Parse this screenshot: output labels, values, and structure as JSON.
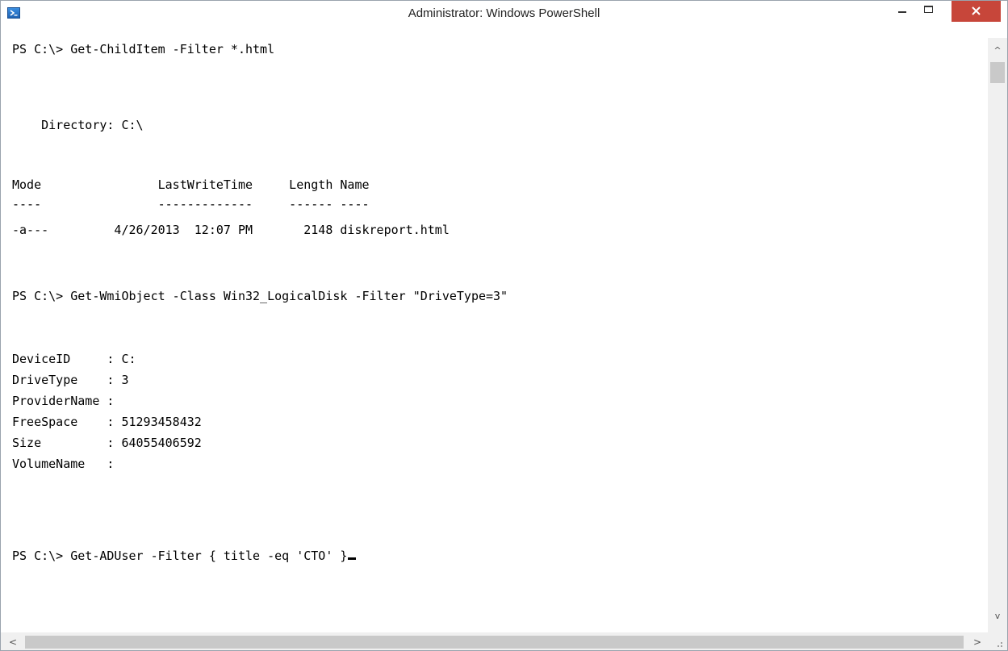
{
  "window": {
    "title": "Administrator: Windows PowerShell",
    "icon": "powershell-icon",
    "controls": [
      "minimize-icon",
      "maximize-icon",
      "close-icon"
    ],
    "close_color": "#c7463a"
  },
  "console": {
    "lines": [
      "PS C:\\> Get-ChildItem -Filter *.html",
      "",
      "",
      "    Directory: C:\\",
      "",
      "",
      "Mode                LastWriteTime     Length Name",
      "----                -------------     ------ ----",
      "-a---         4/26/2013  12:07 PM       2148 diskreport.html",
      "",
      "",
      "PS C:\\> Get-WmiObject -Class Win32_LogicalDisk -Filter \"DriveType=3\"",
      "",
      "",
      "DeviceID     : C:",
      "DriveType    : 3",
      "ProviderName :",
      "FreeSpace    : 51293458432",
      "Size         : 64055406592",
      "VolumeName   :",
      "",
      "",
      "",
      "PS C:\\> Get-ADUser -Filter { title -eq 'CTO' }"
    ]
  },
  "scrollbars": {
    "up_arrow": "^",
    "down_arrow": "v",
    "left_arrow": "<",
    "right_arrow": ">"
  }
}
